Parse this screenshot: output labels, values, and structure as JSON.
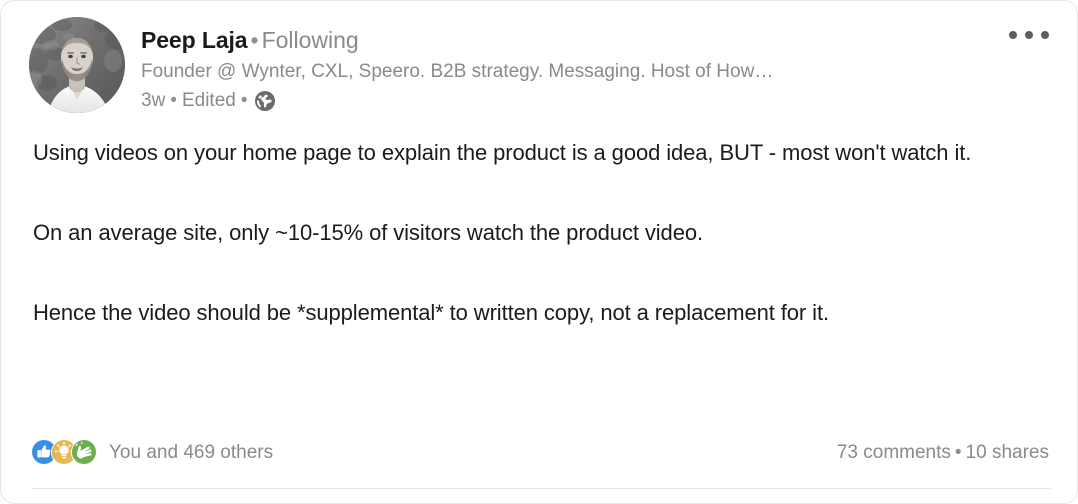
{
  "post": {
    "author": {
      "name": "Peep Laja",
      "follow_state": "Following",
      "headline": "Founder @ Wynter, CXL, Speero. B2B strategy. Messaging. Host of How…",
      "avatar_alt": "Peep Laja profile photo"
    },
    "meta": {
      "timestamp": "3w",
      "edited_label": "Edited",
      "visibility_icon": "globe-icon",
      "separator": "•"
    },
    "overflow_menu_label": "More options",
    "content": "Using videos on your home page to explain the product is a good idea, BUT - most won't watch it.\n\nOn an average site, only ~10-15% of visitors watch the product video.\n\nHence the video should be *supplemental* to written copy, not a replacement for it.",
    "social": {
      "reactions": [
        {
          "name": "like-reaction-icon",
          "color": "#378fe9"
        },
        {
          "name": "insightful-reaction-icon",
          "color": "#f5bb5c"
        },
        {
          "name": "celebrate-reaction-icon",
          "color": "#6dae4f"
        }
      ],
      "reaction_count_label": "You and 469 others",
      "comments_label": "73 comments",
      "shares_label": "10 shares",
      "separator": "•"
    }
  },
  "colors": {
    "text_primary": "#1b1b1b",
    "text_secondary": "#8a8a8a",
    "card_border": "#e8e8e8",
    "divider": "#e4e6e8",
    "background": "#ffffff"
  }
}
